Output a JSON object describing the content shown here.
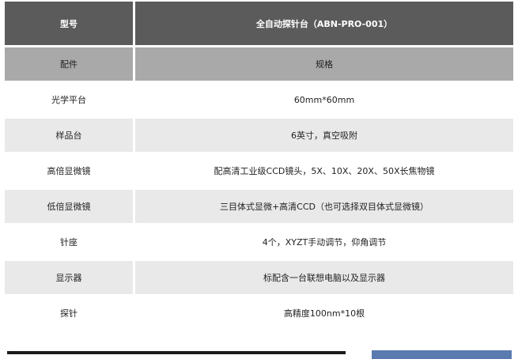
{
  "table": {
    "header": {
      "label": "型号",
      "value": "全自动探针台（ABN-PRO-001）"
    },
    "subheader": {
      "label": "配件",
      "value": "规格"
    },
    "rows": [
      {
        "label": "光学平台",
        "value": "60mm*60mm"
      },
      {
        "label": "样品台",
        "value": "6英寸，真空吸附"
      },
      {
        "label": "高倍显微镜",
        "value": "配高清工业级CCD镜头，5X、10X、20X、50X长焦物镜"
      },
      {
        "label": "低倍显微镜",
        "value": "三目体式显微+高清CCD（也可选择双目体式显微镜）"
      },
      {
        "label": "针座",
        "value": "4个，XYZT手动调节，仰角调节"
      },
      {
        "label": "显示器",
        "value": "标配含一台联想电脑以及显示器"
      },
      {
        "label": "探针",
        "value": "高精度100nm*10根"
      }
    ]
  },
  "colors": {
    "header_bg": "#5b5b5b",
    "subheader_bg": "#a9a9a9",
    "shaded_row_bg": "#e9e9e9",
    "footer_dark": "#1c1c1c",
    "footer_blue": "#5a7bb0"
  }
}
